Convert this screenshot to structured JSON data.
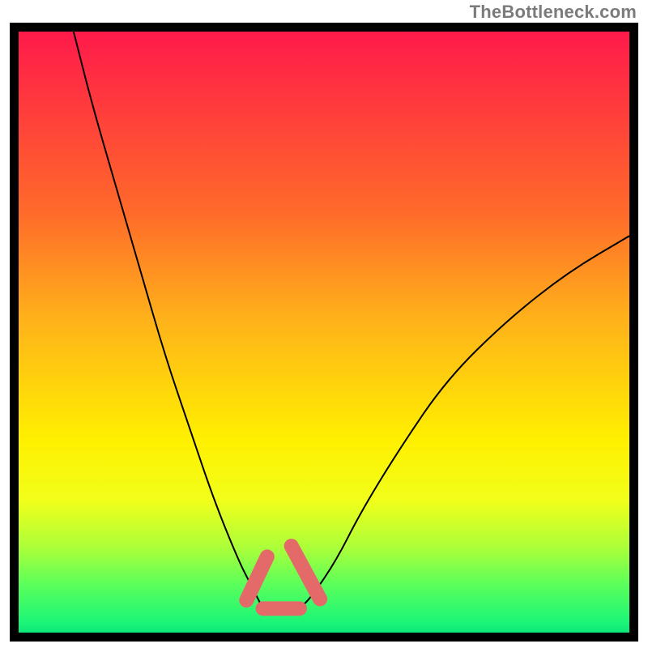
{
  "watermark": {
    "text": "TheBottleneck.com"
  },
  "chart_data": {
    "type": "line",
    "title": "",
    "xlabel": "",
    "ylabel": "",
    "xlim": [
      0,
      100
    ],
    "ylim": [
      0,
      100
    ],
    "background_gradient": {
      "direction": "vertical",
      "stops": [
        {
          "pos": 0,
          "color": "#ff1a4b"
        },
        {
          "pos": 30,
          "color": "#ff6a2a"
        },
        {
          "pos": 68,
          "color": "#fff000"
        },
        {
          "pos": 92,
          "color": "#5bff5b"
        },
        {
          "pos": 100,
          "color": "#0de878"
        }
      ]
    },
    "series": [
      {
        "name": "left-branch",
        "color": "#000000",
        "x": [
          9,
          12,
          16,
          20,
          24,
          28,
          32,
          36,
          38,
          40
        ],
        "y": [
          100,
          88,
          74,
          60,
          46,
          34,
          22,
          12,
          8,
          4
        ]
      },
      {
        "name": "right-branch",
        "color": "#000000",
        "x": [
          46,
          48,
          52,
          56,
          62,
          70,
          80,
          90,
          100
        ],
        "y": [
          4,
          6,
          12,
          20,
          30,
          42,
          52,
          60,
          66
        ]
      }
    ],
    "floor": {
      "name": "valley-floor",
      "color": "#e46a6a",
      "x": [
        40,
        46
      ],
      "y": [
        4,
        4
      ]
    },
    "marks": [
      {
        "name": "mark-left",
        "shape": "capsule",
        "x": 39,
        "y": 9,
        "angle": -65,
        "length": 8,
        "color": "#e46a6a"
      },
      {
        "name": "mark-right",
        "shape": "capsule",
        "x": 47,
        "y": 10,
        "angle": 62,
        "length": 10,
        "color": "#e46a6a"
      }
    ]
  }
}
